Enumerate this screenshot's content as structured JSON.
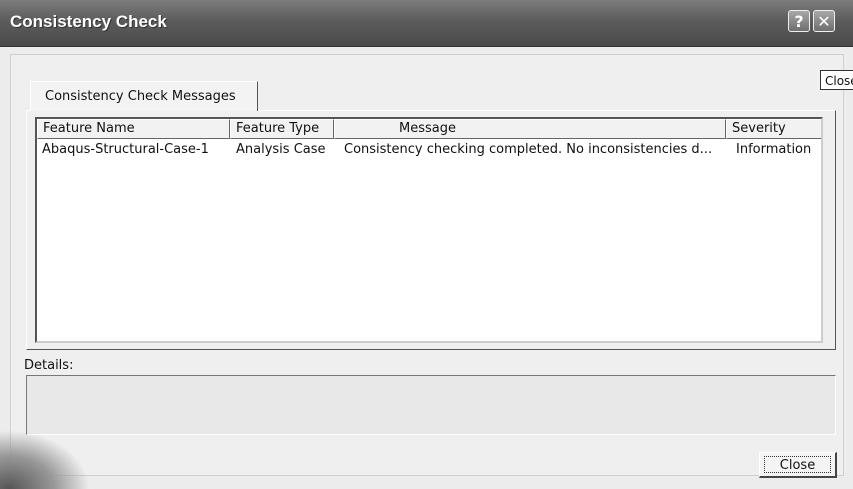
{
  "window": {
    "title": "Consistency Check",
    "help_glyph": "?",
    "close_glyph": "✕",
    "tooltip": "Close"
  },
  "tabs": [
    {
      "label": "Consistency Check Messages",
      "active": true
    }
  ],
  "table": {
    "columns": [
      "Feature Name",
      "Feature Type",
      "Message",
      "Severity"
    ],
    "rows": [
      {
        "feature_name": "Abaqus-Structural-Case-1",
        "feature_type": "Analysis Case",
        "message": "Consistency checking completed. No inconsistencies d...",
        "severity": "Information"
      }
    ]
  },
  "details": {
    "label": "Details:",
    "value": ""
  },
  "footer": {
    "close_label": "Close"
  },
  "icons": {
    "help": "help-icon",
    "close": "close-icon"
  }
}
